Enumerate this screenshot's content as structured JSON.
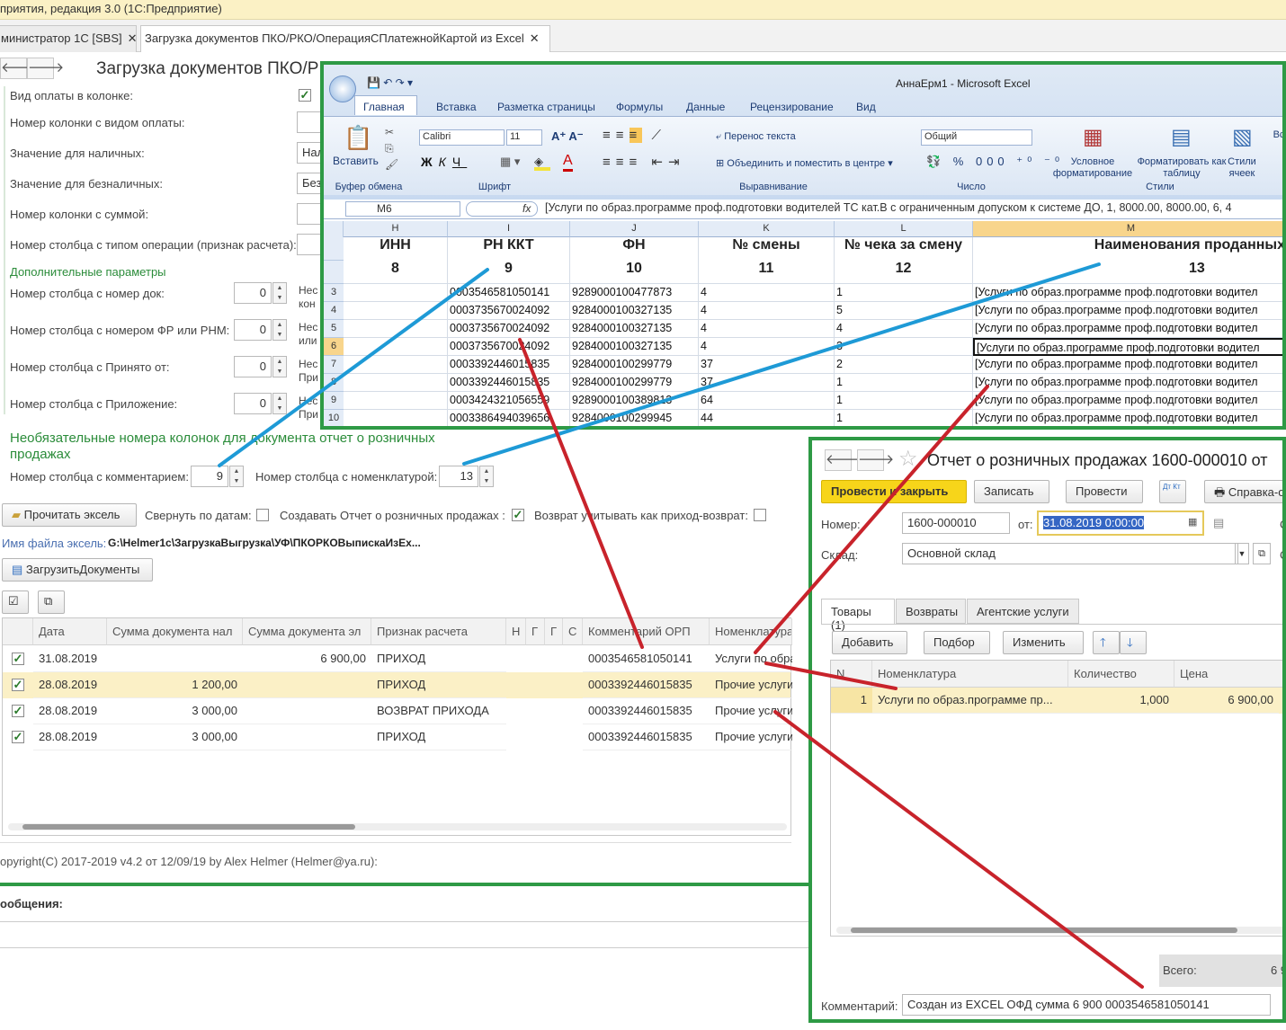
{
  "app": {
    "title": "приятия, редакция 3.0  (1С:Предприятие)"
  },
  "tabs": [
    {
      "label": "министратор 1С [SBS]"
    },
    {
      "label": "Загрузка документов ПКО/РКО/ОперацияСПлатежнойКартой  из Excel"
    }
  ],
  "form": {
    "title": "Загрузка документов ПКО/Р",
    "fields": {
      "pay_type_in_col": "Вид оплаты в колонке:",
      "pay_type_col": "Номер колонки с видом оплаты:",
      "cash_value": "Значение для наличных:",
      "cash_value_text": "Нал",
      "noncash_value": "Значение для безналичных:",
      "noncash_value_text": "Без",
      "sum_col": "Номер колонки с суммой:",
      "op_type_col": "Номер столбца с типом операции (признак расчета):",
      "extra_header": "Дополнительные параметры",
      "doc_num_col": "Номер столбца с номер док:",
      "doc_num_hint": "Нес",
      "doc_num_hint2": "кон",
      "fr_col": "Номер столбца с номером ФР или РНМ:",
      "fr_hint": "Нес",
      "fr_hint2": "или",
      "received_col": "Номер столбца с Принято от:",
      "received_hint": "Нес",
      "received_hint2": "При",
      "attach_col": "Номер столбца с Приложение:",
      "attach_hint": "Нес",
      "attach_hint2": "При",
      "zero": "0",
      "optional_header": "Необязательные номера колонок для документа отчет о розничных продажах",
      "comment_col": "Номер столбца с комментарием:",
      "comment_col_val": "9",
      "nomen_col": "Номер столбца с номенклатурой:",
      "nomen_col_val": "13"
    },
    "read_excel_btn": "Прочитать эксель",
    "collapse_dates": "Свернуть по датам:",
    "create_report": "Создавать Отчет о розничных продажах :",
    "return_as": "Возврат учитывать как приход-возврат:",
    "file_label": "Имя файла эксель:",
    "file_path": "G:\\Helmer1c\\ЗагрузкаВыгрузка\\УФ\\ПКОРКОВыпискаИзЕх...",
    "load_btn": "ЗагрузитьДокументы",
    "copyright": "opyright(C)  2017-2019 v4.2 от 12/09/19 by Alex Helmer (Helmer@ya.ru):",
    "messages": "ообщения:"
  },
  "table": {
    "headers": [
      "Дата",
      "Сумма документа нал",
      "Сумма документа эл",
      "Признак расчета",
      "Н",
      "Г",
      "Г",
      "С",
      "Комментарий ОРП",
      "Номенклатура"
    ],
    "rows": [
      {
        "date": "31.08.2019",
        "cash": "",
        "el": "6 900,00",
        "sign": "ПРИХОД",
        "comment": "0003546581050141",
        "nomen": "Услуги по обра"
      },
      {
        "date": "28.08.2019",
        "cash": "1 200,00",
        "el": "",
        "sign": "ПРИХОД",
        "comment": "0003392446015835",
        "nomen": "Прочие услуги"
      },
      {
        "date": "28.08.2019",
        "cash": "3 000,00",
        "el": "",
        "sign": "ВОЗВРАТ ПРИХОДА",
        "comment": "0003392446015835",
        "nomen": "Прочие услуги"
      },
      {
        "date": "28.08.2019",
        "cash": "3 000,00",
        "el": "",
        "sign": "ПРИХОД",
        "comment": "0003392446015835",
        "nomen": "Прочие услуги"
      }
    ]
  },
  "excel": {
    "title": "АннаЕрм1 - Microsoft Excel",
    "ribbon_tabs": [
      "Главная",
      "Вставка",
      "Разметка страницы",
      "Формулы",
      "Данные",
      "Рецензирование",
      "Вид"
    ],
    "paste": "Вставить",
    "clipboard": "Буфер обмена",
    "font_name": "Calibri",
    "font_size": "11",
    "font_group": "Шрифт",
    "wrap_text": "Перенос текста",
    "merge_center": "Объединить и поместить в центре",
    "align_group": "Выравнивание",
    "number_format": "Общий",
    "number_group": "Число",
    "cond_format": "Условное форматирование",
    "format_table": "Форматировать как таблицу",
    "cell_styles": "Стили ячеек",
    "styles_group": "Стили",
    "insert_short": "Вс",
    "cell_ref": "M6",
    "formula": "[Услуги по образ.программе проф.подготовки водителей ТС кат.В с ограниченным допуском к системе ДО, 1, 8000.00, 8000.00, 6, 4",
    "col_letters": [
      "H",
      "I",
      "J",
      "K",
      "L",
      "M"
    ],
    "headers": [
      "ИНН",
      "РН ККТ",
      "ФН",
      "№ смены",
      "№ чека за смену",
      "Наименования проданных"
    ],
    "col_nums": [
      "8",
      "9",
      "10",
      "11",
      "12",
      "13"
    ],
    "row_nums": [
      "3",
      "4",
      "5",
      "6",
      "7",
      "8",
      "9",
      "10"
    ],
    "rows": [
      [
        "",
        "0003546581050141",
        "9289000100477873",
        "4",
        "1",
        "[Услуги по образ.программе проф.подготовки водител"
      ],
      [
        "",
        "0003735670024092",
        "9284000100327135",
        "4",
        "5",
        "[Услуги по образ.программе проф.подготовки водител"
      ],
      [
        "",
        "0003735670024092",
        "9284000100327135",
        "4",
        "4",
        "[Услуги по образ.программе проф.подготовки водител"
      ],
      [
        "",
        "0003735670024092",
        "9284000100327135",
        "4",
        "3",
        "[Услуги по образ.программе проф.подготовки водител"
      ],
      [
        "",
        "0003392446015835",
        "9284000100299779",
        "37",
        "2",
        "[Услуги по образ.программе проф.подготовки водител"
      ],
      [
        "",
        "0003392446015835",
        "9284000100299779",
        "37",
        "1",
        "[Услуги по образ.программе проф.подготовки водител"
      ],
      [
        "",
        "0003424321056559",
        "9289000100389813",
        "64",
        "1",
        "[Услуги по образ.программе проф.подготовки водител"
      ],
      [
        "",
        "0003386494039656",
        "9284000100299945",
        "44",
        "1",
        "[Услуги по образ.программе проф.подготовки водител"
      ]
    ]
  },
  "report": {
    "title": "Отчет о розничных продажах 1600-000010 от",
    "post_close": "Провести и закрыть",
    "save": "Записать",
    "post": "Провести",
    "dtkt": "Дт Кт",
    "help": "Справка-о",
    "number_label": "Номер:",
    "number": "1600-000010",
    "from_label": "от:",
    "date": "31.08.2019  0:00:00",
    "c_label": "С",
    "warehouse_label": "Склад:",
    "warehouse": "Основной склад",
    "tabs": [
      "Товары (1)",
      "Возвраты",
      "Агентские услуги"
    ],
    "add": "Добавить",
    "pick": "Подбор",
    "change": "Изменить",
    "grid_headers": [
      "N",
      "Номенклатура",
      "Количество",
      "Цена"
    ],
    "row": {
      "n": "1",
      "nomen": "Услуги по образ.программе пр...",
      "qty": "1,000",
      "price": "6 900,00"
    },
    "total_label": "Всего:",
    "total_val": "6 9",
    "comment_label": "Комментарий:",
    "comment": "Создан из EXCEL ОФД сумма 6 900 0003546581050141"
  },
  "colors": {
    "frame": "#2e9a45",
    "blue_line": "#1e9ad6",
    "red_line": "#c8232b",
    "highlight": "#fbf0c6",
    "post_button": "#f7d51a"
  }
}
